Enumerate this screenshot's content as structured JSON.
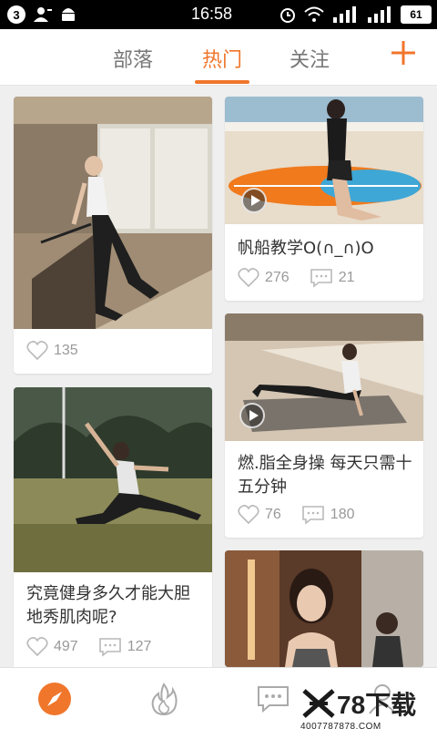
{
  "status_bar": {
    "notification_count": "3",
    "time": "16:58",
    "battery": "61"
  },
  "tabs": [
    {
      "label": "部落",
      "active": false
    },
    {
      "label": "热门",
      "active": true
    },
    {
      "label": "关注",
      "active": false
    }
  ],
  "add_button_icon": "plus-icon",
  "cards": [
    {
      "title": "",
      "likes": "135",
      "comments": "",
      "has_video": false
    },
    {
      "title": "帆船教学O(∩_∩)O",
      "likes": "276",
      "comments": "21",
      "has_video": true
    },
    {
      "title": "究竟健身多久才能大胆地秀肌肉呢?",
      "title_line1": "究竟健身多久才能大胆",
      "title_line2": "地秀肌肉呢?",
      "likes": "497",
      "comments": "127",
      "has_video": false
    },
    {
      "title": "燃.脂全身操 每天只需十五分钟",
      "title_line1": "燃.脂全身操 每天只需十",
      "title_line2": "五分钟",
      "likes": "76",
      "comments": "180",
      "has_video": true
    },
    {
      "title": "",
      "likes": "",
      "comments": "",
      "has_video": false
    }
  ],
  "bottom_nav": [
    {
      "icon": "compass-icon",
      "active": true
    },
    {
      "icon": "flame-icon",
      "active": false
    },
    {
      "icon": "chat-icon",
      "active": false
    },
    {
      "icon": "user-icon",
      "active": false
    }
  ],
  "watermark": {
    "logo": "78下载",
    "url": "4007787878.COM"
  },
  "colors": {
    "accent": "#f0762b",
    "text": "#333333",
    "meta": "#999999"
  }
}
